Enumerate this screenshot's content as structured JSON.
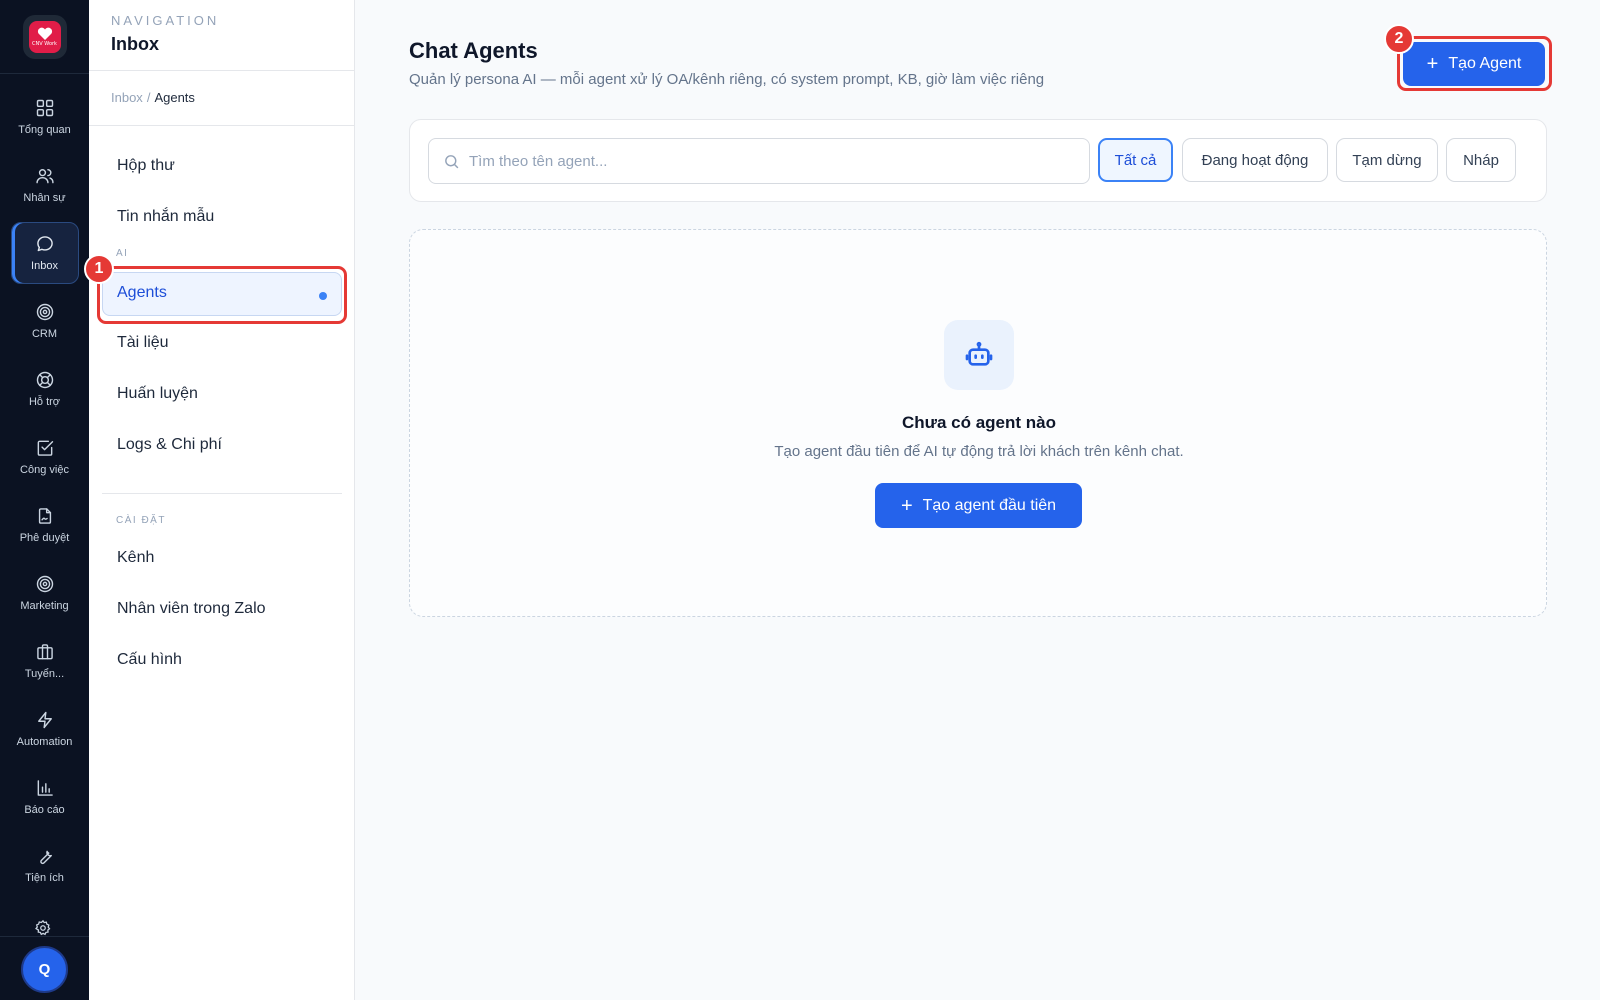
{
  "rail": {
    "logo_text": "CNV Work",
    "items": [
      {
        "label": "Tổng quan",
        "icon": "grid-icon"
      },
      {
        "label": "Nhân sự",
        "icon": "users-icon"
      },
      {
        "label": "Inbox",
        "icon": "chat-bubble-icon",
        "active": true
      },
      {
        "label": "CRM",
        "icon": "target-icon"
      },
      {
        "label": "Hỗ trợ",
        "icon": "lifebuoy-icon"
      },
      {
        "label": "Công việc",
        "icon": "checkbox-icon"
      },
      {
        "label": "Phê duyệt",
        "icon": "file-signature-icon"
      },
      {
        "label": "Marketing",
        "icon": "target-icon"
      },
      {
        "label": "Tuyển...",
        "icon": "briefcase-icon"
      },
      {
        "label": "Automation",
        "icon": "bolt-icon"
      },
      {
        "label": "Báo cáo",
        "icon": "bar-chart-icon"
      },
      {
        "label": "Tiện ích",
        "icon": "wrench-icon"
      }
    ],
    "avatar_initial": "Q"
  },
  "subnav": {
    "kicker": "NAVIGATION",
    "title": "Inbox",
    "breadcrumb": {
      "parent": "Inbox",
      "separator": "/",
      "current": "Agents"
    },
    "items_top": [
      {
        "label": "Hộp thư"
      },
      {
        "label": "Tin nhắn mẫu"
      }
    ],
    "section_ai": "AI",
    "items_ai": [
      {
        "label": "Agents",
        "active": true
      },
      {
        "label": "Tài liệu"
      },
      {
        "label": "Huấn luyện"
      },
      {
        "label": "Logs & Chi phí"
      }
    ],
    "section_settings": "CÀI ĐẶT",
    "items_settings": [
      {
        "label": "Kênh"
      },
      {
        "label": "Nhân viên trong Zalo"
      },
      {
        "label": "Cấu hình"
      }
    ]
  },
  "annotations": {
    "badge_1": "1",
    "badge_2": "2",
    "highlight_color": "#e53935"
  },
  "main": {
    "title": "Chat Agents",
    "subtitle": "Quản lý persona AI — mỗi agent xử lý OA/kênh riêng, có system prompt, KB, giờ làm việc riêng",
    "create_button": "Tạo Agent",
    "search_placeholder": "Tìm theo tên agent...",
    "filters": [
      {
        "label": "Tất cả",
        "active": true
      },
      {
        "label": "Đang hoạt động"
      },
      {
        "label": "Tạm dừng"
      },
      {
        "label": "Nháp"
      }
    ],
    "empty": {
      "icon": "bot-icon",
      "title": "Chưa có agent nào",
      "description": "Tạo agent đầu tiên để AI tự động trả lời khách trên kênh chat.",
      "button": "Tạo agent đầu tiên"
    }
  },
  "colors": {
    "accent": "#2563eb",
    "rail_bg": "#0b1222",
    "page_bg": "#f8fafc"
  }
}
